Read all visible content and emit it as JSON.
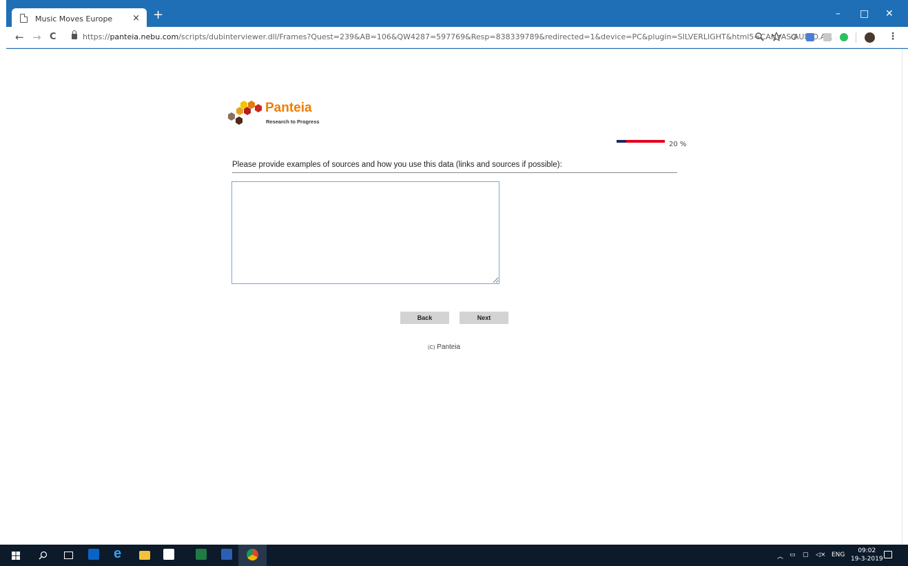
{
  "browser": {
    "tab_title": "Music Moves Europe",
    "tab_close": "×",
    "new_tab": "+",
    "window_controls": [
      "–",
      "□",
      "✕"
    ],
    "url_scheme": "https://",
    "url_host": "panteia.nebu.com",
    "url_path": "/scripts/dubinterviewer.dll/Frames?Quest=239&AB=106&QW4287=597769&Resp=838339789&redirected=1&device=PC&plugin=SILVERLIGHT&html5=CANVAS.AUDIO.A...",
    "nav": {
      "back": "←",
      "forward": "→",
      "reload": "C"
    },
    "toolbar_icons": [
      "zoom-icon",
      "star-icon",
      "extension-icon",
      "translate-icon",
      "pdf-icon",
      "evernote-icon",
      "profile-avatar",
      "menu-icon"
    ]
  },
  "survey": {
    "logo_name": "Panteia",
    "logo_tagline": "Research to Progress",
    "progress_value": 20,
    "progress_label": "20 %",
    "question": "Please provide examples of sources and how you use this data (links and sources if possible):",
    "answer_value": "",
    "back_label": "Back",
    "next_label": "Next",
    "copyright_prefix": "(C)",
    "copyright_name": "Panteia"
  },
  "taskbar": {
    "apps": [
      "windows-start",
      "search",
      "task-view",
      "outlook",
      "edge",
      "file-explorer",
      "store",
      "excel",
      "word",
      "chrome"
    ],
    "language": "ENG",
    "time": "09:02",
    "date": "19-3-2019"
  },
  "colors": {
    "chrome_blue": "#1e6fb5",
    "brand_orange": "#f07c00",
    "progress_red": "#e3001b",
    "progress_navy": "#1a2a5e"
  }
}
